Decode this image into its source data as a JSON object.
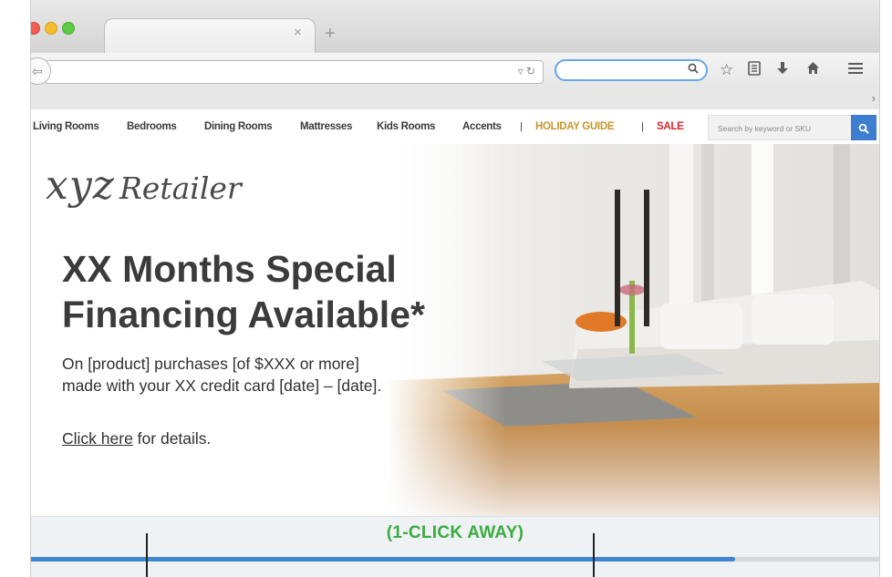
{
  "browser": {
    "new_tab_glyph": "+",
    "close_tab_glyph": "×",
    "url_value": "",
    "search_value": "",
    "toolbar_icons": [
      "star-icon",
      "reading-list-icon",
      "download-icon",
      "home-icon",
      "menu-icon"
    ]
  },
  "site_nav": {
    "items": [
      "Living Rooms",
      "Bedrooms",
      "Dining Rooms",
      "Mattresses",
      "Kids Rooms",
      "Accents"
    ],
    "separator": "|",
    "holiday": "HOLIDAY GUIDE",
    "sale": "SALE",
    "search_placeholder": "Search by keyword or SKU"
  },
  "hero": {
    "logo_xyz": "xyz",
    "logo_retailer": "Retailer",
    "headline_line1": "XX Months Special",
    "headline_line2": "Financing Available*",
    "sub_line1": "On [product] purchases [of $XXX or more]",
    "sub_line2": "made with your XX credit card [date] – [date].",
    "details_link": "Click here",
    "details_rest": " for details."
  },
  "annotation": {
    "label": "(1-CLICK AWAY)",
    "progress": 0.83
  },
  "colors": {
    "holiday": "#c8962e",
    "sale": "#d0282e",
    "accent_blue": "#3d7ed0",
    "annotation_green": "#3bab3f"
  }
}
